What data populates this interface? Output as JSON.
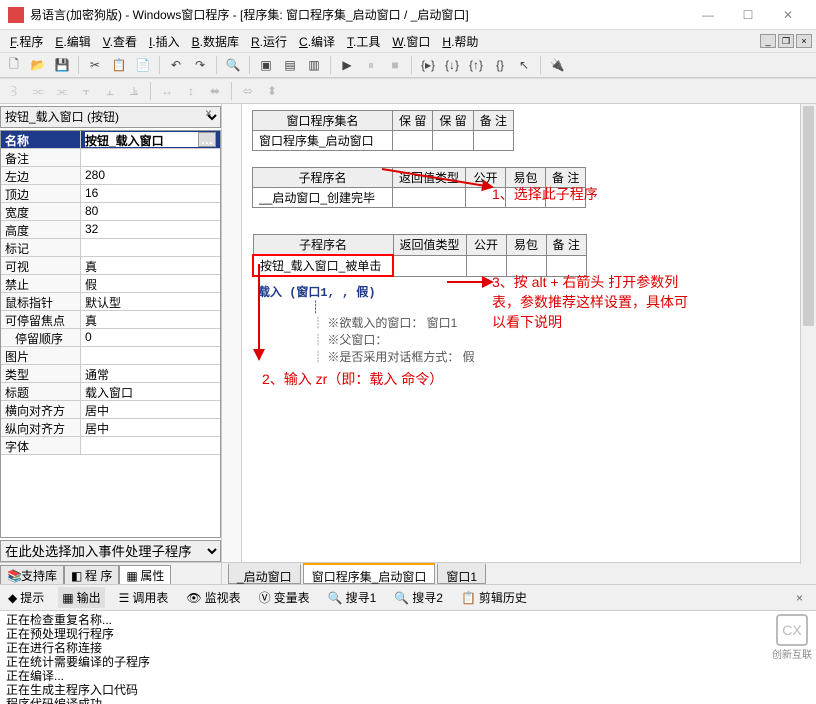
{
  "titlebar": {
    "app_name": "易语言(加密狗版)",
    "doc_title": " - Windows窗口程序 - [程序集: 窗口程序集_启动窗口 / _启动窗口]"
  },
  "menus": [
    "F.程序",
    "E.编辑",
    "V.查看",
    "I.插入",
    "B.数据库",
    "R.运行",
    "C.编译",
    "T.工具",
    "W.窗口",
    "H.帮助"
  ],
  "left": {
    "combo_selected": "按钮_载入窗口 (按钮)",
    "header": "名称",
    "name_value": "按钮_载入窗口",
    "props": [
      {
        "k": "备注",
        "v": ""
      },
      {
        "k": "左边",
        "v": "280"
      },
      {
        "k": "顶边",
        "v": "16"
      },
      {
        "k": "宽度",
        "v": "80"
      },
      {
        "k": "高度",
        "v": "32"
      },
      {
        "k": "标记",
        "v": ""
      },
      {
        "k": "可视",
        "v": "真"
      },
      {
        "k": "禁止",
        "v": "假"
      },
      {
        "k": "鼠标指针",
        "v": "默认型"
      },
      {
        "k": "可停留焦点",
        "v": "真"
      },
      {
        "k": "停留顺序",
        "v": "0",
        "indent": true
      },
      {
        "k": "图片",
        "v": ""
      },
      {
        "k": "类型",
        "v": "通常"
      },
      {
        "k": "标题",
        "v": "载入窗口"
      },
      {
        "k": "横向对齐方式",
        "v": "居中"
      },
      {
        "k": "纵向对齐方式",
        "v": "居中"
      },
      {
        "k": "字体",
        "v": ""
      }
    ],
    "event_placeholder": "在此处选择加入事件处理子程序",
    "tabs": [
      "支持库",
      "程 序",
      "属性"
    ]
  },
  "code": {
    "table1": {
      "headers": [
        "窗口程序集名",
        "保 留",
        "保 留",
        "备 注"
      ],
      "row": [
        "窗口程序集_启动窗口",
        "",
        "",
        ""
      ]
    },
    "table2": {
      "headers": [
        "子程序名",
        "返回值类型",
        "公开",
        "易包",
        "备 注"
      ],
      "row": [
        "__启动窗口_创建完毕",
        "",
        "",
        "",
        ""
      ]
    },
    "table3": {
      "headers": [
        "子程序名",
        "返回值类型",
        "公开",
        "易包",
        "备 注"
      ],
      "row": [
        "按钮_载入窗口_被单击",
        "",
        "",
        "",
        ""
      ]
    },
    "load_line": "载入 (窗口1, , 假)",
    "params": [
      "※欲载入的窗口：  窗口1",
      "※父窗口：",
      "※是否采用对话框方式：  假"
    ],
    "ann1": "1、选择此子程序",
    "ann2": "2、输入 zr（即：载入 命令）",
    "ann3a": "3、按 alt + 右箭头 打开参数列",
    "ann3b": "表，参数推荐这样设置，具体可",
    "ann3c": "以看下说明"
  },
  "bottom_tabs": [
    "_启动窗口",
    "窗口程序集_启动窗口",
    "窗口1"
  ],
  "output": {
    "tabs": [
      "提示",
      "输出",
      "调用表",
      "监视表",
      "变量表",
      "搜寻1",
      "搜寻2",
      "剪辑历史"
    ],
    "lines": [
      "正在检查重复名称...",
      "正在预处理现行程序",
      "正在进行名称连接",
      "正在统计需要编译的子程序",
      "正在编译...",
      "正在生成主程序入口代码",
      "程序代码编译成功"
    ]
  },
  "watermark": "创新互联"
}
